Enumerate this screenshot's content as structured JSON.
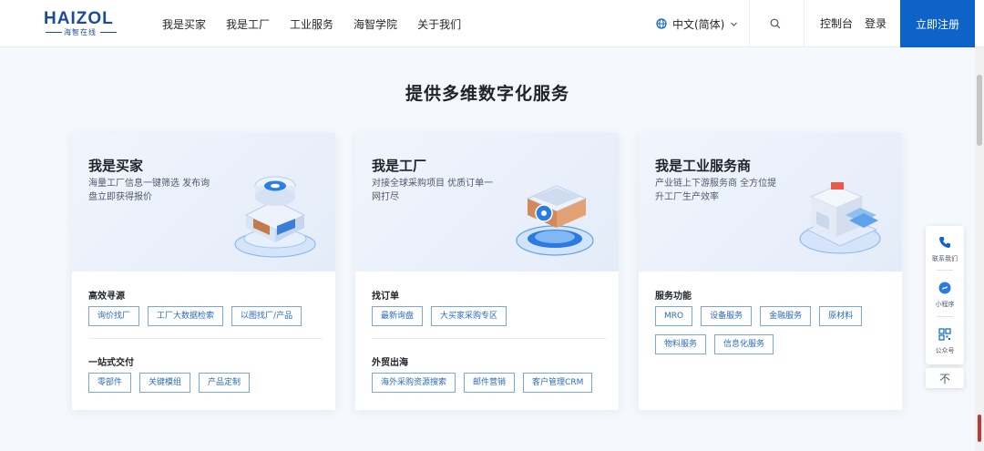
{
  "header": {
    "logo": "HAIZOL",
    "logo_sub": "海智在线",
    "nav": [
      "我是买家",
      "我是工厂",
      "工业服务",
      "海智学院",
      "关于我们"
    ],
    "language": "中文(简体)",
    "console": "控制台",
    "login": "登录",
    "register": "立即注册"
  },
  "section": {
    "title": "提供多维数字化服务"
  },
  "cards": [
    {
      "title": "我是买家",
      "desc": "海量工厂信息一键筛选 发布询盘立即获得报价",
      "groups": [
        {
          "label": "高效寻源",
          "tags": [
            "询价找厂",
            "工厂大数据检索",
            "以图找厂/产品"
          ]
        },
        {
          "label": "一站式交付",
          "tags": [
            "零部件",
            "关键模组",
            "产品定制"
          ]
        }
      ]
    },
    {
      "title": "我是工厂",
      "desc": "对接全球采购项目 优质订单一网打尽",
      "groups": [
        {
          "label": "找订单",
          "tags": [
            "最新询盘",
            "大买家采购专区"
          ]
        },
        {
          "label": "外贸出海",
          "tags": [
            "海外采购资源搜索",
            "邮件营销",
            "客户管理CRM"
          ]
        }
      ]
    },
    {
      "title": "我是工业服务商",
      "desc": "产业链上下游服务商 全方位提升工厂生产效率",
      "groups": [
        {
          "label": "服务功能",
          "tags": [
            "MRO",
            "设备服务",
            "金融服务",
            "原材料",
            "物料服务",
            "信息化服务"
          ]
        }
      ]
    }
  ],
  "float_bar": {
    "contact": "联系我们",
    "mini_program": "小程序",
    "official_account": "公众号",
    "back_top": "不"
  },
  "colors": {
    "brand": "#0d63c8",
    "tag_border": "#7aa6dc",
    "tag_text": "#2a6bc0"
  }
}
